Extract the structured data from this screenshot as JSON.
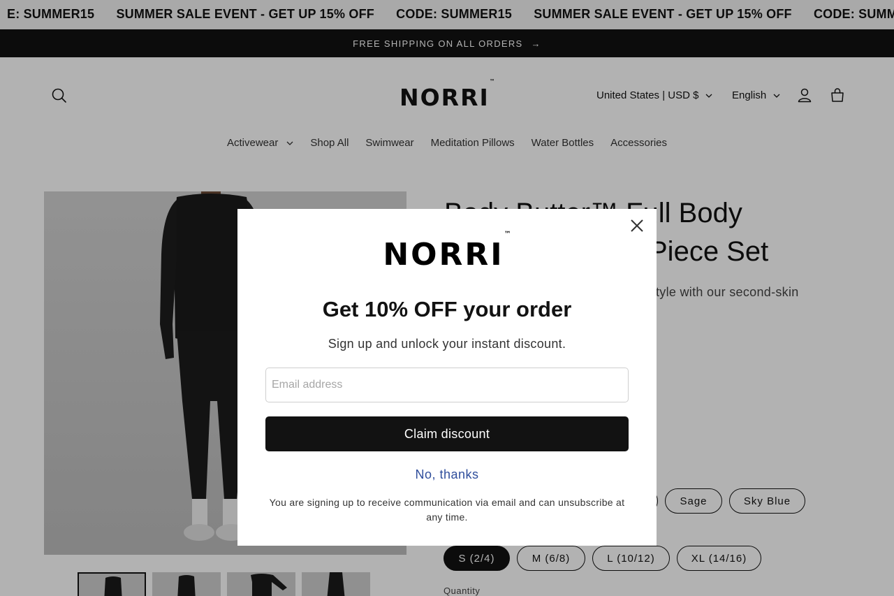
{
  "marquee": {
    "items": [
      "E: SUMMER15",
      "SUMMER SALE EVENT - GET UP 15% OFF",
      "CODE: SUMMER15",
      "SUMMER SALE EVENT - GET UP 15% OFF",
      "CODE: SUMME"
    ]
  },
  "announcement": {
    "text": "FREE SHIPPING ON ALL ORDERS",
    "arrow": "→"
  },
  "header": {
    "logo": "NORRI",
    "logo_tm": "™",
    "country_currency": "United States | USD $",
    "language": "English",
    "icons": [
      "search-icon",
      "account-icon",
      "cart-icon"
    ]
  },
  "nav": {
    "items": [
      "Activewear",
      "Shop All",
      "Swimwear",
      "Meditation Pillows",
      "Water Bottles",
      "Accessories"
    ]
  },
  "product": {
    "title_line1": "Body Butter™ Full Body",
    "title_line2": "Piece Set",
    "desc_fragment": "tyle with our second-skin",
    "colors": [
      "Sage",
      "Sky Blue"
    ],
    "sizes": [
      "S (2/4)",
      "M (6/8)",
      "L (10/12)",
      "XL (14/16)"
    ],
    "selected_size": "S (2/4)",
    "quantity_label": "Quantity"
  },
  "modal": {
    "logo": "NORRI",
    "logo_tm": "™",
    "heading": "Get 10% OFF your order",
    "subheading": "Sign up and unlock your instant discount.",
    "email_placeholder": "Email address",
    "claim_label": "Claim discount",
    "no_thanks_label": "No, thanks",
    "disclaimer": "You are signing up to receive communication via email and can unsubscribe at any time."
  }
}
